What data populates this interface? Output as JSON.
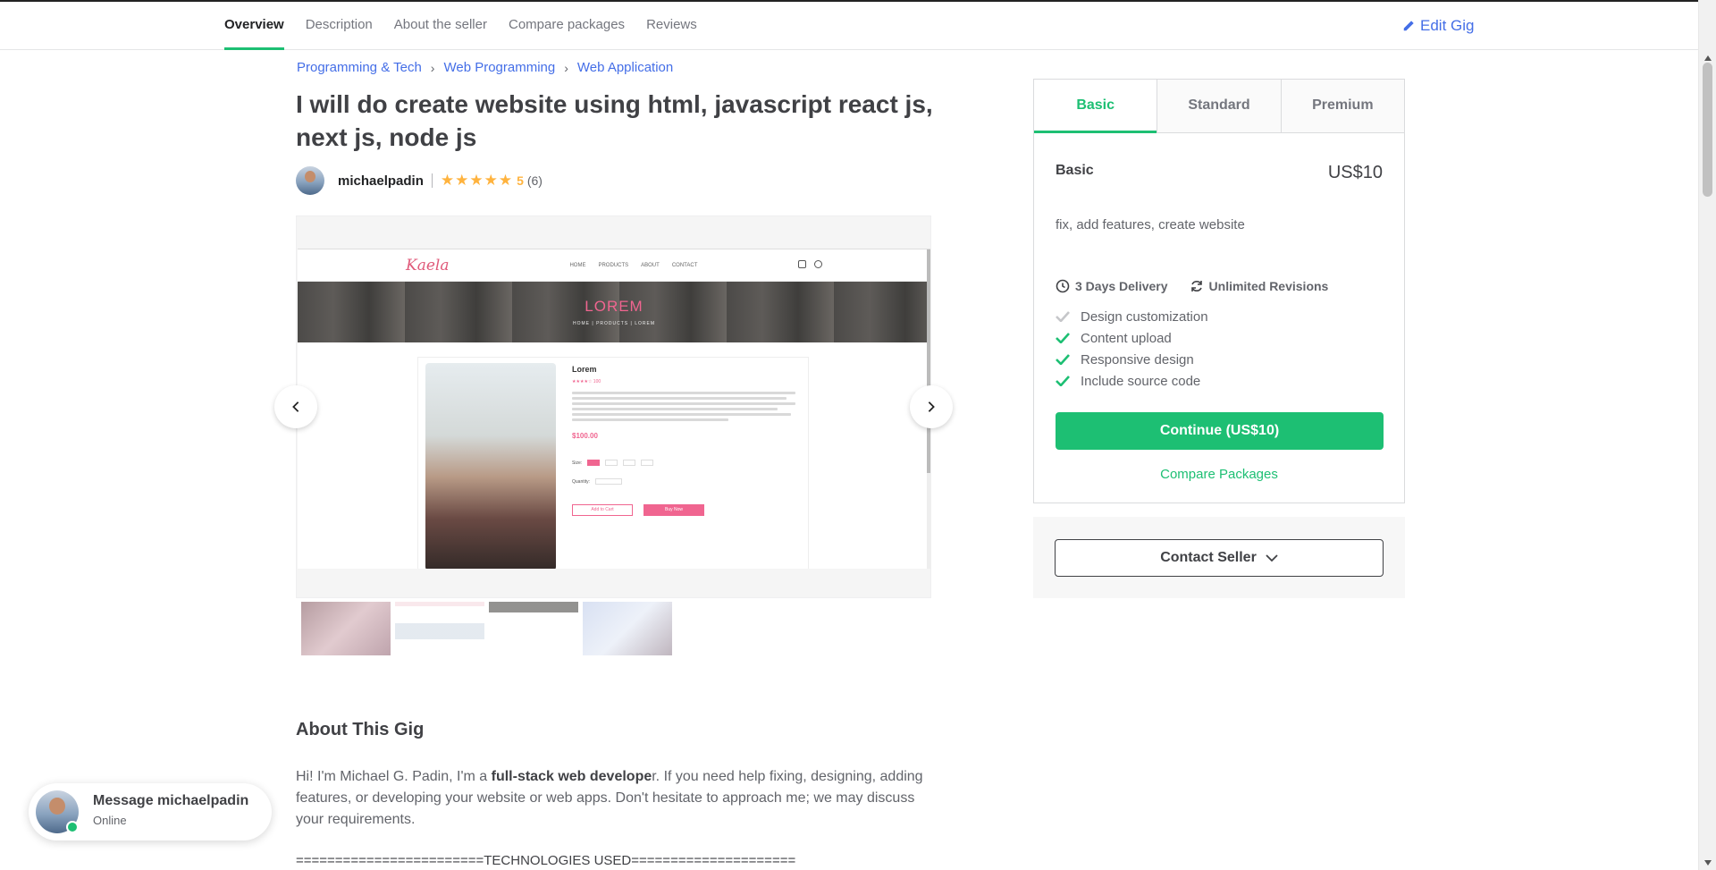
{
  "nav": {
    "tabs": [
      {
        "label": "Overview"
      },
      {
        "label": "Description"
      },
      {
        "label": "About the seller"
      },
      {
        "label": "Compare packages"
      },
      {
        "label": "Reviews"
      }
    ],
    "edit_label": "Edit Gig",
    "edit_icon": "pencil-icon"
  },
  "breadcrumb": [
    "Programming & Tech",
    "Web Programming",
    "Web Application"
  ],
  "gig": {
    "title": "I will do create website using html, javascript react js, next js, node js",
    "seller": "michaelpadin",
    "rating": "5",
    "review_count": "(6)",
    "stars": "★★★★★"
  },
  "preview": {
    "logo": "Kaela",
    "nav_links": [
      "HOME",
      "PRODUCTS",
      "ABOUT",
      "CONTACT"
    ],
    "hero_title": "LOREM",
    "hero_crumbs": "HOME  |  PRODUCTS  |  LOREM",
    "product_name": "Lorem",
    "product_stars": "★★★★☆ 100",
    "product_price": "$100.00",
    "size_label": "Size:",
    "sizes": [
      "S",
      "M",
      "L",
      "XL"
    ],
    "quantity_label": "Quantity:",
    "add_to_cart": "Add to Cart",
    "buy_now": "Buy Now"
  },
  "about": {
    "title": "About This Gig",
    "intro_before": "Hi! I'm Michael G. Padin, I'm a ",
    "intro_bold": "full-stack web develope",
    "intro_after": "r. If you need help fixing, designing, adding features, or developing your website or web apps. Don't hesitate to approach me; we may discuss your requirements.",
    "tech_line": "========================TECHNOLOGIES USED====================="
  },
  "package": {
    "tabs": [
      "Basic",
      "Standard",
      "Premium"
    ],
    "active_tab": "Basic",
    "name": "Basic",
    "price": "US$10",
    "description": "fix, add features, create website",
    "delivery": "3 Days Delivery",
    "revisions": "Unlimited Revisions",
    "features": [
      {
        "label": "Design customization",
        "included": false
      },
      {
        "label": "Content upload",
        "included": true
      },
      {
        "label": "Responsive design",
        "included": true
      },
      {
        "label": "Include source code",
        "included": true
      }
    ],
    "continue_label": "Continue (US$10)",
    "compare_label": "Compare Packages"
  },
  "contact": {
    "label": "Contact Seller"
  },
  "chat": {
    "title": "Message michaelpadin",
    "status": "Online"
  },
  "colors": {
    "accent": "#1dbf73",
    "link": "#446ee7",
    "star": "#ffb33e"
  }
}
